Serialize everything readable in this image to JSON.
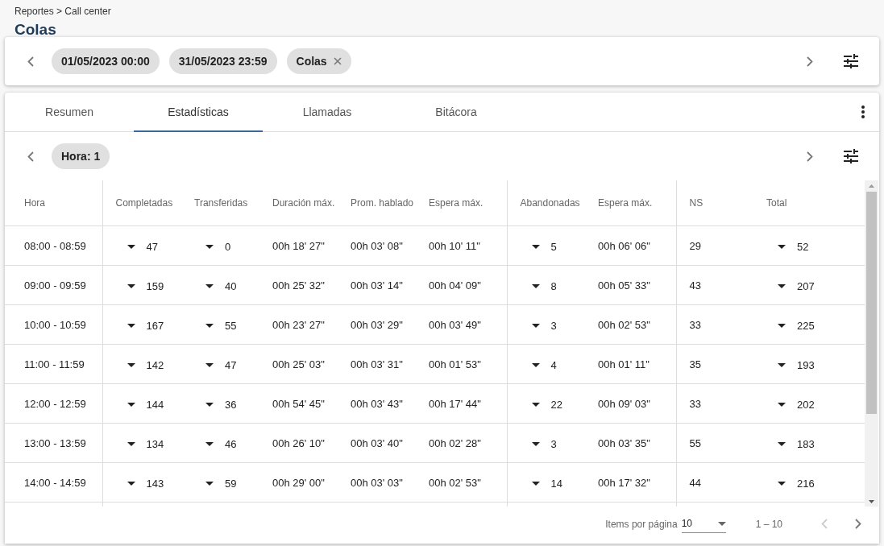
{
  "breadcrumb": "Reportes > Call center",
  "title": "Colas",
  "filters": [
    {
      "label": "01/05/2023 00:00",
      "removable": false
    },
    {
      "label": "31/05/2023 23:59",
      "removable": false
    },
    {
      "label": "Colas",
      "removable": true
    }
  ],
  "tabs": [
    {
      "label": "Resumen",
      "selected": false
    },
    {
      "label": "Estadísticas",
      "selected": true
    },
    {
      "label": "Llamadas",
      "selected": false
    },
    {
      "label": "Bitácora",
      "selected": false
    }
  ],
  "sub_filters": [
    {
      "label": "Hora: 1",
      "removable": false
    }
  ],
  "table": {
    "columns": [
      {
        "label": "Hora",
        "kind": "text"
      },
      {
        "label": "Completadas",
        "kind": "expand"
      },
      {
        "label": "Transferidas",
        "kind": "expand"
      },
      {
        "label": "Duración máx.",
        "kind": "text"
      },
      {
        "label": "Prom. hablado",
        "kind": "text"
      },
      {
        "label": "Espera máx.",
        "kind": "text"
      },
      {
        "label": "Abandonadas",
        "kind": "expand"
      },
      {
        "label": "Espera máx.",
        "kind": "text"
      },
      {
        "label": "NS",
        "kind": "text"
      },
      {
        "label": "Total",
        "kind": "expand"
      }
    ],
    "rows": [
      [
        "08:00 - 08:59",
        "47",
        "0",
        "00h 18' 27\"",
        "00h 03' 08\"",
        "00h 10' 11\"",
        "5",
        "00h 06' 06\"",
        "29",
        "52"
      ],
      [
        "09:00 - 09:59",
        "159",
        "40",
        "00h 25' 32\"",
        "00h 03' 14\"",
        "00h 04' 09\"",
        "8",
        "00h 05' 33\"",
        "43",
        "207"
      ],
      [
        "10:00 - 10:59",
        "167",
        "55",
        "00h 23' 27\"",
        "00h 03' 29\"",
        "00h 03' 49\"",
        "3",
        "00h 02' 53\"",
        "33",
        "225"
      ],
      [
        "11:00 - 11:59",
        "142",
        "47",
        "00h 25' 03\"",
        "00h 03' 31\"",
        "00h 01' 53\"",
        "4",
        "00h 01' 11\"",
        "35",
        "193"
      ],
      [
        "12:00 - 12:59",
        "144",
        "36",
        "00h 54' 45\"",
        "00h 03' 43\"",
        "00h 17' 44\"",
        "22",
        "00h 09' 03\"",
        "33",
        "202"
      ],
      [
        "13:00 - 13:59",
        "134",
        "46",
        "00h 26' 10\"",
        "00h 03' 40\"",
        "00h 02' 28\"",
        "3",
        "00h 03' 35\"",
        "55",
        "183"
      ],
      [
        "14:00 - 14:59",
        "143",
        "59",
        "00h 29' 00\"",
        "00h 03' 03\"",
        "00h 02' 53\"",
        "14",
        "00h 17' 32\"",
        "44",
        "216"
      ]
    ]
  },
  "pagination": {
    "label": "Items por página",
    "page_size": "10",
    "range": "1 – 10",
    "prev_disabled": true,
    "next_disabled": false
  }
}
